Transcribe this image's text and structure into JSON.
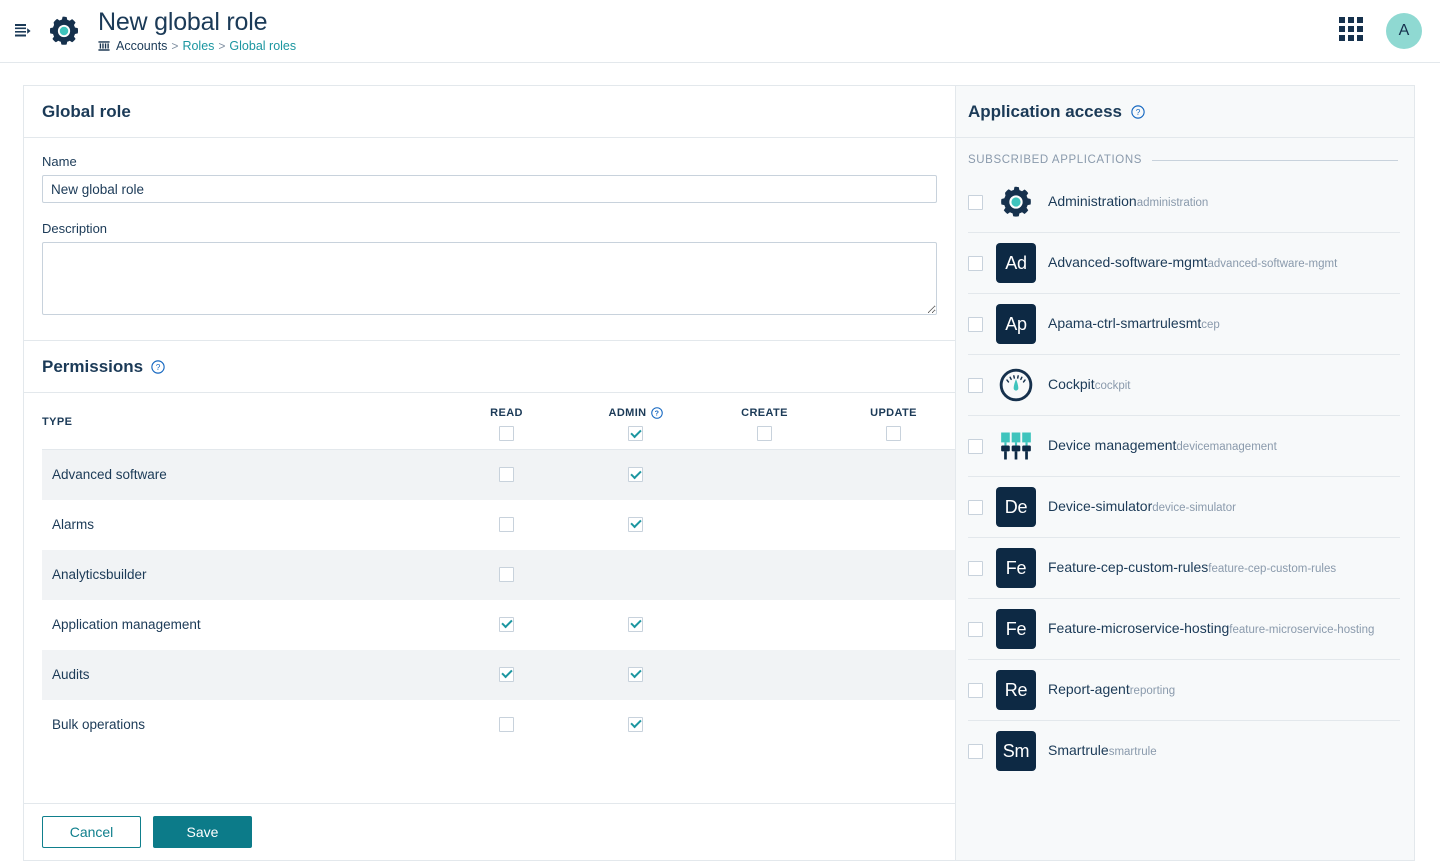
{
  "topbar": {
    "collapse_icon": "collapse-sidebar-icon",
    "app_icon": "administration-gear-icon",
    "title": "New global role",
    "breadcrumb": {
      "icon": "bank-icon",
      "items": [
        {
          "label": "Accounts",
          "link": false
        },
        {
          "label": "Roles",
          "link": true
        },
        {
          "label": "Global roles",
          "link": true
        }
      ],
      "separator": ">"
    },
    "grid_icon": "app-switcher-grid-icon",
    "avatar_initial": "A"
  },
  "global_role": {
    "section_title": "Global role",
    "name_label": "Name",
    "name_value": "New global role",
    "description_label": "Description",
    "description_value": "",
    "description_placeholder": ""
  },
  "permissions": {
    "section_title": "Permissions",
    "help_icon": "help-circle-icon",
    "columns": [
      {
        "key": "type",
        "label": "TYPE"
      },
      {
        "key": "read",
        "label": "READ"
      },
      {
        "key": "admin",
        "label": "ADMIN",
        "help": true
      },
      {
        "key": "create",
        "label": "CREATE"
      },
      {
        "key": "update",
        "label": "UPDATE"
      }
    ],
    "header_checkboxes": {
      "read": false,
      "admin": true,
      "create": false,
      "update": false
    },
    "rows": [
      {
        "type": "Advanced software",
        "read": false,
        "admin": true,
        "has_read": true,
        "has_admin": true,
        "has_create": false,
        "has_update": false
      },
      {
        "type": "Alarms",
        "read": false,
        "admin": true,
        "has_read": true,
        "has_admin": true,
        "has_create": false,
        "has_update": false
      },
      {
        "type": "Analyticsbuilder",
        "read": false,
        "admin": false,
        "has_read": true,
        "has_admin": false,
        "has_create": false,
        "has_update": false
      },
      {
        "type": "Application management",
        "read": true,
        "admin": true,
        "has_read": true,
        "has_admin": true,
        "has_create": false,
        "has_update": false
      },
      {
        "type": "Audits",
        "read": true,
        "admin": true,
        "has_read": true,
        "has_admin": true,
        "has_create": false,
        "has_update": false
      },
      {
        "type": "Bulk operations",
        "read": false,
        "admin": true,
        "has_read": true,
        "has_admin": true,
        "has_create": false,
        "has_update": false
      }
    ]
  },
  "footer": {
    "cancel_label": "Cancel",
    "save_label": "Save"
  },
  "application_access": {
    "section_title": "Application access",
    "help_icon": "help-circle-icon",
    "group_label": "SUBSCRIBED APPLICATIONS",
    "apps": [
      {
        "name": "Administration",
        "key": "administration",
        "checked": false,
        "icon": "gear-icon",
        "icon_type": "gear"
      },
      {
        "name": "Advanced-software-mgmt",
        "key": "advanced-software-mgmt",
        "checked": false,
        "icon": "tile-icon",
        "icon_type": "tile",
        "initials": "Ad"
      },
      {
        "name": "Apama-ctrl-smartrulesmt",
        "key": "cep",
        "checked": false,
        "icon": "tile-icon",
        "icon_type": "tile",
        "initials": "Ap"
      },
      {
        "name": "Cockpit",
        "key": "cockpit",
        "checked": false,
        "icon": "gauge-icon",
        "icon_type": "gauge"
      },
      {
        "name": "Device management",
        "key": "devicemanagement",
        "checked": false,
        "icon": "device-connectors-icon",
        "icon_type": "devices"
      },
      {
        "name": "Device-simulator",
        "key": "device-simulator",
        "checked": false,
        "icon": "tile-icon",
        "icon_type": "tile",
        "initials": "De"
      },
      {
        "name": "Feature-cep-custom-rules",
        "key": "feature-cep-custom-rules",
        "checked": false,
        "icon": "tile-icon",
        "icon_type": "tile",
        "initials": "Fe"
      },
      {
        "name": "Feature-microservice-hosting",
        "key": "feature-microservice-hosting",
        "checked": false,
        "icon": "tile-icon",
        "icon_type": "tile",
        "initials": "Fe"
      },
      {
        "name": "Report-agent",
        "key": "reporting",
        "checked": false,
        "icon": "tile-icon",
        "icon_type": "tile",
        "initials": "Re"
      },
      {
        "name": "Smartrule",
        "key": "smartrule",
        "checked": false,
        "icon": "tile-icon",
        "icon_type": "tile",
        "initials": "Sm"
      }
    ]
  },
  "colors": {
    "accent_teal": "#0c7b89",
    "brand_navy": "#1b3a57",
    "tile_navy": "#0d2944",
    "icon_teal": "#3fc4bd",
    "link_teal": "#1b96a0",
    "avatar_teal": "#8fd9d2",
    "muted": "#8a9aac",
    "border": "#e3e8ec",
    "stripe": "#f1f3f5",
    "panel_bg": "#f7f9fa"
  }
}
